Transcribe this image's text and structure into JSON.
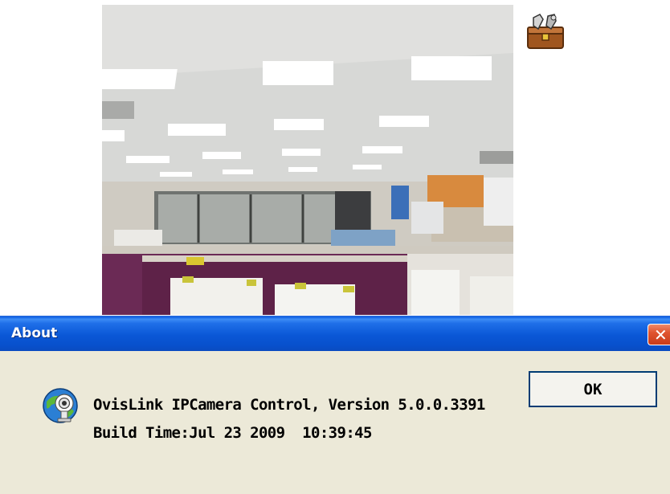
{
  "dialog": {
    "title": "About",
    "app_line": "OvisLink IPCamera Control, Version 5.0.0.3391",
    "build_line": "Build Time:Jul 23 2009  10:39:45",
    "ok_label": "OK",
    "close_icon": "close-icon"
  },
  "icons": {
    "toolbox": "toolbox-icon",
    "about": "camera-globe-icon"
  },
  "colors": {
    "titlebar": "#0a57d6",
    "dialog_bg": "#ece9d8",
    "close_button": "#d84a27"
  }
}
